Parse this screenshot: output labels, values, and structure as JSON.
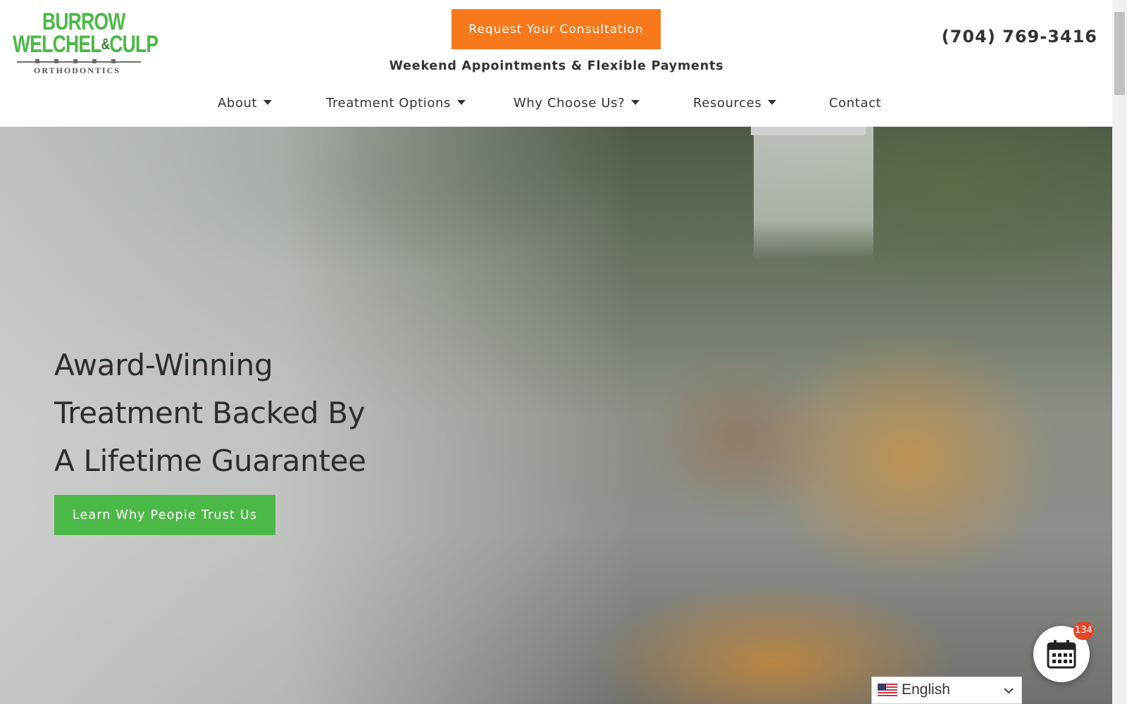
{
  "header": {
    "logo": {
      "line1": "BURROW",
      "line2a": "WELCHEL",
      "amp": "&",
      "line2b": "CULP",
      "subtitle": "ORTHODONTICS"
    },
    "cta_label": "Request Your Consultation",
    "tagline": "Weekend Appointments & Flexible Payments",
    "phone": "(704) 769-3416"
  },
  "nav": {
    "items": [
      {
        "label": "About"
      },
      {
        "label": "Treatment Options"
      },
      {
        "label": "Why Choose Us?"
      },
      {
        "label": "Resources"
      },
      {
        "label": "Contact"
      }
    ]
  },
  "hero": {
    "title_lines": [
      "Award-Winning",
      "Treatment Backed By",
      "A Lifetime Guarantee"
    ],
    "button_label": "Learn Why People Trust Us"
  },
  "widgets": {
    "calendar_icon": "calendar-icon",
    "calendar_badge": "134",
    "language": "English",
    "language_flag": "us-flag-icon"
  },
  "colors": {
    "brand_green": "#4cb848",
    "cta_orange": "#f7791c",
    "text_dark": "#333333",
    "badge_red": "#e5452a"
  }
}
